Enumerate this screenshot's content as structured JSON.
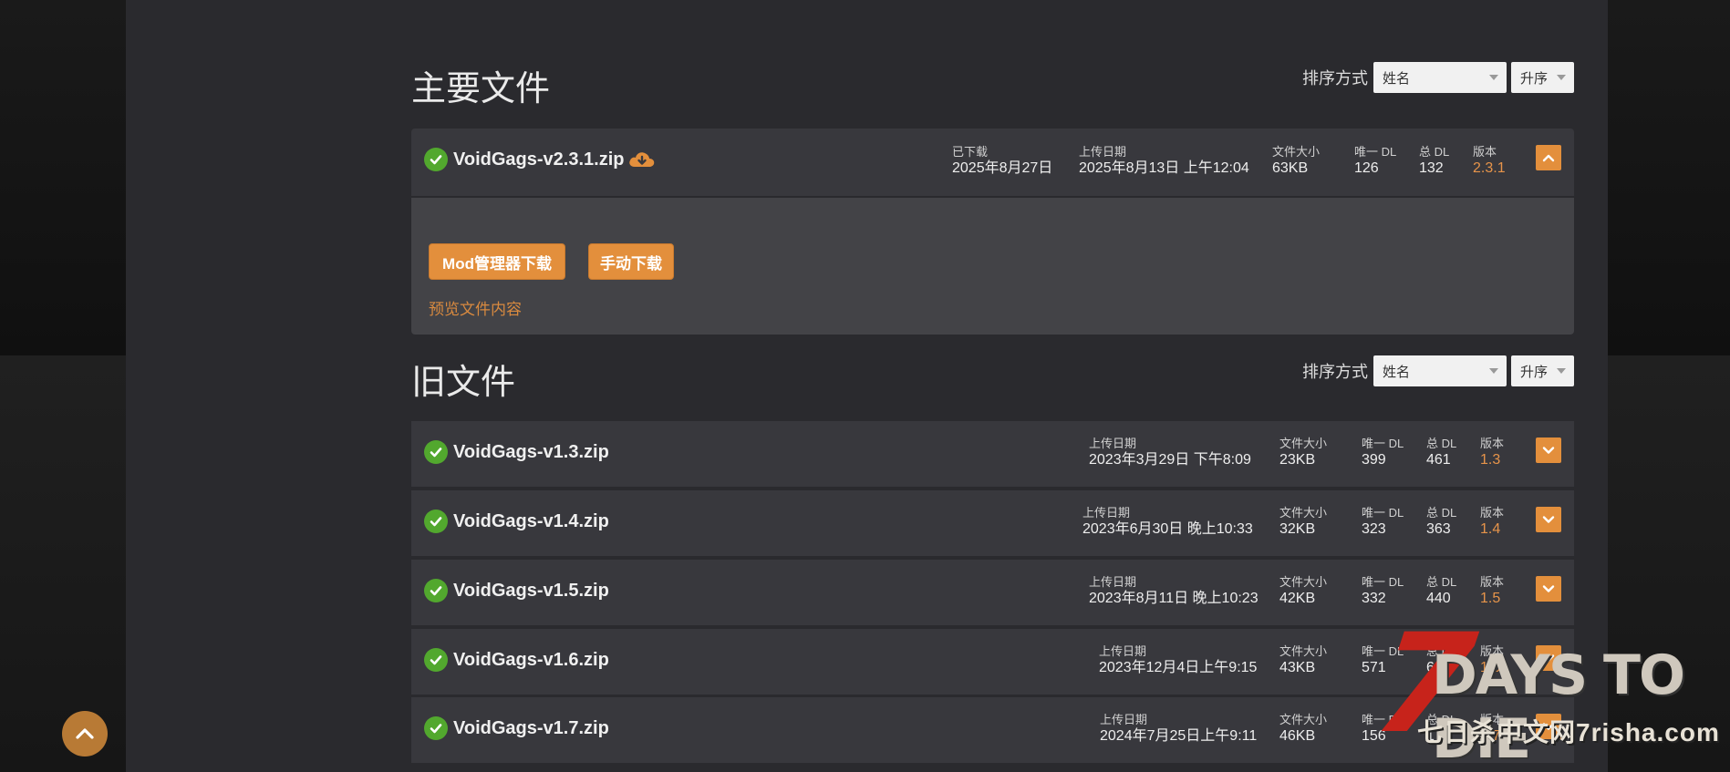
{
  "main_section": {
    "title": "主要文件",
    "sort": {
      "label": "排序方式",
      "field": "姓名",
      "order": "升序"
    },
    "files": [
      {
        "name": "VoidGags-v2.3.1.zip",
        "downloaded_label": "已下载",
        "downloaded": "2025年8月27日",
        "upload_label": "上传日期",
        "upload": "2025年8月13日 上午12:04",
        "size_label": "文件大小",
        "size": "63KB",
        "unique_label": "唯一 DL",
        "unique": "126",
        "total_label": "总 DL",
        "total": "132",
        "version_label": "版本",
        "version": "2.3.1"
      }
    ],
    "expanded": {
      "mod_manager_button": "Mod管理器下载",
      "manual_button": "手动下载",
      "preview_link": "预览文件内容"
    }
  },
  "old_section": {
    "title": "旧文件",
    "sort": {
      "label": "排序方式",
      "field": "姓名",
      "order": "升序"
    },
    "files": [
      {
        "name": "VoidGags-v1.3.zip",
        "upload_label": "上传日期",
        "upload": "2023年3月29日 下午8:09",
        "size_label": "文件大小",
        "size": "23KB",
        "unique_label": "唯一 DL",
        "unique": "399",
        "total_label": "总 DL",
        "total": "461",
        "version_label": "版本",
        "version": "1.3"
      },
      {
        "name": "VoidGags-v1.4.zip",
        "upload_label": "上传日期",
        "upload": "2023年6月30日 晚上10:33",
        "size_label": "文件大小",
        "size": "32KB",
        "unique_label": "唯一 DL",
        "unique": "323",
        "total_label": "总 DL",
        "total": "363",
        "version_label": "版本",
        "version": "1.4"
      },
      {
        "name": "VoidGags-v1.5.zip",
        "upload_label": "上传日期",
        "upload": "2023年8月11日 晚上10:23",
        "size_label": "文件大小",
        "size": "42KB",
        "unique_label": "唯一 DL",
        "unique": "332",
        "total_label": "总 DL",
        "total": "440",
        "version_label": "版本",
        "version": "1.5"
      },
      {
        "name": "VoidGags-v1.6.zip",
        "upload_label": "上传日期",
        "upload": "2023年12月4日上午9:15",
        "size_label": "文件大小",
        "size": "43KB",
        "unique_label": "唯一 DL",
        "unique": "571",
        "total_label": "总 DL",
        "total": "666",
        "version_label": "版本",
        "version": "1.6"
      },
      {
        "name": "VoidGags-v1.7.zip",
        "upload_label": "上传日期",
        "upload": "2024年7月25日上午9:11",
        "size_label": "文件大小",
        "size": "46KB",
        "unique_label": "唯一 DL",
        "unique": "156",
        "total_label": "总 DL",
        "total": "178",
        "version_label": "版本",
        "version": "1.7"
      }
    ]
  },
  "watermark": {
    "logo_number": "7",
    "logo_title": "DAYS TO DIE",
    "site_text": "七日杀中文网7risha.com"
  },
  "colors": {
    "accent": "#e38f3c",
    "check": "#52a82e",
    "panel": "#2a2a2e",
    "row": "#38383d"
  },
  "icons": {
    "scroll_top": "chevron-up-icon",
    "check": "check-circle-icon",
    "download": "cloud-download-icon"
  }
}
